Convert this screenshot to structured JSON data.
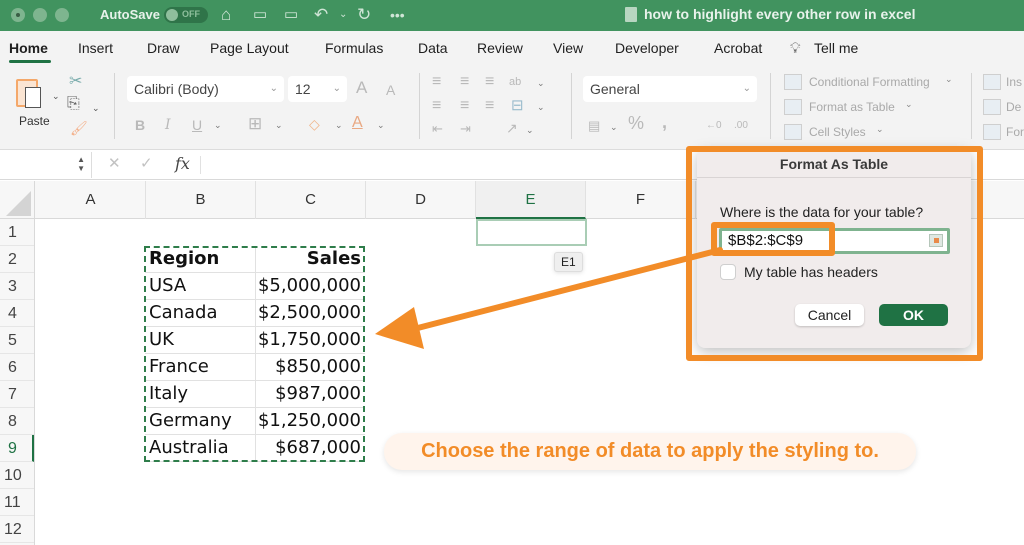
{
  "window": {
    "autosave_label": "AutoSave",
    "autosave_state": "OFF",
    "title": "how to highlight every other row in excel"
  },
  "ribbon_tabs": [
    {
      "label": "Home",
      "active": true
    },
    {
      "label": "Insert"
    },
    {
      "label": "Draw"
    },
    {
      "label": "Page Layout"
    },
    {
      "label": "Formulas"
    },
    {
      "label": "Data"
    },
    {
      "label": "Review"
    },
    {
      "label": "View"
    },
    {
      "label": "Developer"
    },
    {
      "label": "Acrobat"
    },
    {
      "label": "Tell me"
    }
  ],
  "ribbon": {
    "paste_label": "Paste",
    "font_name": "Calibri (Body)",
    "font_size": "12",
    "number_format": "General",
    "conditional_formatting": "Conditional Formatting",
    "format_as_table": "Format as Table",
    "cell_styles": "Cell Styles",
    "insert": "Ins",
    "delete": "De",
    "format": "For"
  },
  "formula_bar": {
    "name_box": "",
    "fx": "fx",
    "content": ""
  },
  "columns": [
    "A",
    "B",
    "C",
    "D",
    "E",
    "F"
  ],
  "selected_column": "E",
  "rows": [
    "1",
    "2",
    "3",
    "4",
    "5",
    "6",
    "7",
    "8",
    "9",
    "10",
    "11",
    "12"
  ],
  "selected_row": "9",
  "cell_tooltip": "E1",
  "table": {
    "headers": [
      "Region",
      "Sales"
    ],
    "rows": [
      [
        "USA",
        "$5,000,000"
      ],
      [
        "Canada",
        "$2,500,000"
      ],
      [
        "UK",
        "$1,750,000"
      ],
      [
        "France",
        "$850,000"
      ],
      [
        "Italy",
        "$987,000"
      ],
      [
        "Germany",
        "$1,250,000"
      ],
      [
        "Australia",
        "$687,000"
      ]
    ]
  },
  "dialog": {
    "title": "Format As Table",
    "question": "Where is the data for your table?",
    "range_value": "$B$2:$C$9",
    "checkbox_label": "My table has headers",
    "checkbox_checked": false,
    "cancel_label": "Cancel",
    "ok_label": "OK"
  },
  "annotation": {
    "callout": "Choose the range of data to apply the styling to.",
    "accent_color": "#f28c28"
  },
  "colors": {
    "excel_green": "#1f7244",
    "titlebar_green": "#41935f"
  }
}
